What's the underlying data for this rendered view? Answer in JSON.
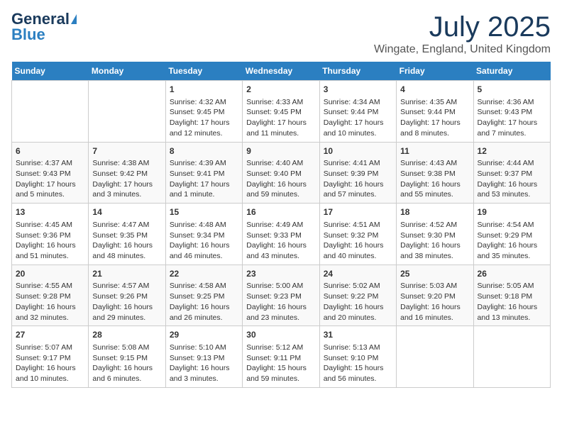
{
  "logo": {
    "text_general": "General",
    "text_blue": "Blue"
  },
  "title": {
    "month_year": "July 2025",
    "location": "Wingate, England, United Kingdom"
  },
  "days_of_week": [
    "Sunday",
    "Monday",
    "Tuesday",
    "Wednesday",
    "Thursday",
    "Friday",
    "Saturday"
  ],
  "weeks": [
    [
      {
        "day": "",
        "content": ""
      },
      {
        "day": "",
        "content": ""
      },
      {
        "day": "1",
        "content": "Sunrise: 4:32 AM\nSunset: 9:45 PM\nDaylight: 17 hours and 12 minutes."
      },
      {
        "day": "2",
        "content": "Sunrise: 4:33 AM\nSunset: 9:45 PM\nDaylight: 17 hours and 11 minutes."
      },
      {
        "day": "3",
        "content": "Sunrise: 4:34 AM\nSunset: 9:44 PM\nDaylight: 17 hours and 10 minutes."
      },
      {
        "day": "4",
        "content": "Sunrise: 4:35 AM\nSunset: 9:44 PM\nDaylight: 17 hours and 8 minutes."
      },
      {
        "day": "5",
        "content": "Sunrise: 4:36 AM\nSunset: 9:43 PM\nDaylight: 17 hours and 7 minutes."
      }
    ],
    [
      {
        "day": "6",
        "content": "Sunrise: 4:37 AM\nSunset: 9:43 PM\nDaylight: 17 hours and 5 minutes."
      },
      {
        "day": "7",
        "content": "Sunrise: 4:38 AM\nSunset: 9:42 PM\nDaylight: 17 hours and 3 minutes."
      },
      {
        "day": "8",
        "content": "Sunrise: 4:39 AM\nSunset: 9:41 PM\nDaylight: 17 hours and 1 minute."
      },
      {
        "day": "9",
        "content": "Sunrise: 4:40 AM\nSunset: 9:40 PM\nDaylight: 16 hours and 59 minutes."
      },
      {
        "day": "10",
        "content": "Sunrise: 4:41 AM\nSunset: 9:39 PM\nDaylight: 16 hours and 57 minutes."
      },
      {
        "day": "11",
        "content": "Sunrise: 4:43 AM\nSunset: 9:38 PM\nDaylight: 16 hours and 55 minutes."
      },
      {
        "day": "12",
        "content": "Sunrise: 4:44 AM\nSunset: 9:37 PM\nDaylight: 16 hours and 53 minutes."
      }
    ],
    [
      {
        "day": "13",
        "content": "Sunrise: 4:45 AM\nSunset: 9:36 PM\nDaylight: 16 hours and 51 minutes."
      },
      {
        "day": "14",
        "content": "Sunrise: 4:47 AM\nSunset: 9:35 PM\nDaylight: 16 hours and 48 minutes."
      },
      {
        "day": "15",
        "content": "Sunrise: 4:48 AM\nSunset: 9:34 PM\nDaylight: 16 hours and 46 minutes."
      },
      {
        "day": "16",
        "content": "Sunrise: 4:49 AM\nSunset: 9:33 PM\nDaylight: 16 hours and 43 minutes."
      },
      {
        "day": "17",
        "content": "Sunrise: 4:51 AM\nSunset: 9:32 PM\nDaylight: 16 hours and 40 minutes."
      },
      {
        "day": "18",
        "content": "Sunrise: 4:52 AM\nSunset: 9:30 PM\nDaylight: 16 hours and 38 minutes."
      },
      {
        "day": "19",
        "content": "Sunrise: 4:54 AM\nSunset: 9:29 PM\nDaylight: 16 hours and 35 minutes."
      }
    ],
    [
      {
        "day": "20",
        "content": "Sunrise: 4:55 AM\nSunset: 9:28 PM\nDaylight: 16 hours and 32 minutes."
      },
      {
        "day": "21",
        "content": "Sunrise: 4:57 AM\nSunset: 9:26 PM\nDaylight: 16 hours and 29 minutes."
      },
      {
        "day": "22",
        "content": "Sunrise: 4:58 AM\nSunset: 9:25 PM\nDaylight: 16 hours and 26 minutes."
      },
      {
        "day": "23",
        "content": "Sunrise: 5:00 AM\nSunset: 9:23 PM\nDaylight: 16 hours and 23 minutes."
      },
      {
        "day": "24",
        "content": "Sunrise: 5:02 AM\nSunset: 9:22 PM\nDaylight: 16 hours and 20 minutes."
      },
      {
        "day": "25",
        "content": "Sunrise: 5:03 AM\nSunset: 9:20 PM\nDaylight: 16 hours and 16 minutes."
      },
      {
        "day": "26",
        "content": "Sunrise: 5:05 AM\nSunset: 9:18 PM\nDaylight: 16 hours and 13 minutes."
      }
    ],
    [
      {
        "day": "27",
        "content": "Sunrise: 5:07 AM\nSunset: 9:17 PM\nDaylight: 16 hours and 10 minutes."
      },
      {
        "day": "28",
        "content": "Sunrise: 5:08 AM\nSunset: 9:15 PM\nDaylight: 16 hours and 6 minutes."
      },
      {
        "day": "29",
        "content": "Sunrise: 5:10 AM\nSunset: 9:13 PM\nDaylight: 16 hours and 3 minutes."
      },
      {
        "day": "30",
        "content": "Sunrise: 5:12 AM\nSunset: 9:11 PM\nDaylight: 15 hours and 59 minutes."
      },
      {
        "day": "31",
        "content": "Sunrise: 5:13 AM\nSunset: 9:10 PM\nDaylight: 15 hours and 56 minutes."
      },
      {
        "day": "",
        "content": ""
      },
      {
        "day": "",
        "content": ""
      }
    ]
  ]
}
